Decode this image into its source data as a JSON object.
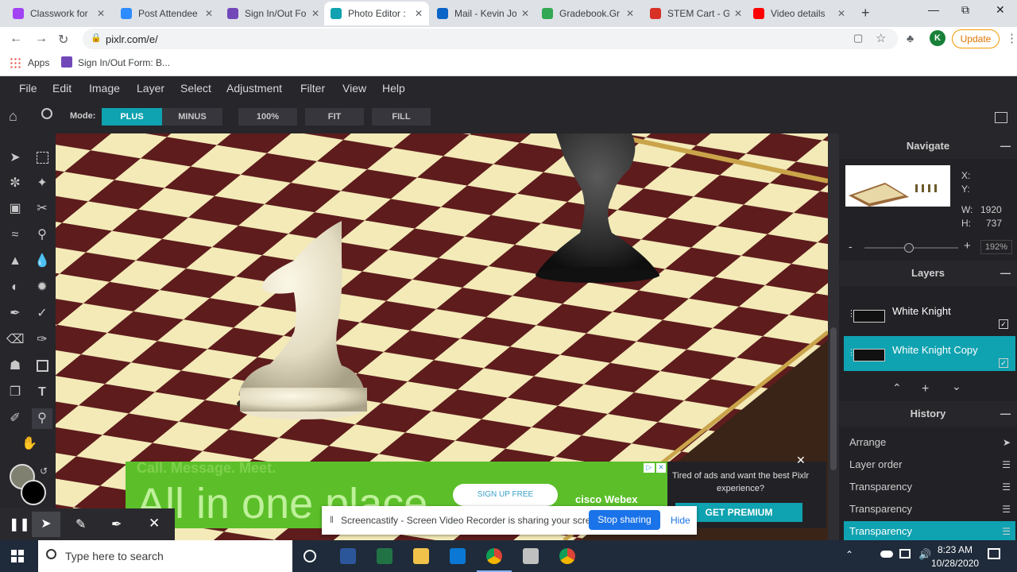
{
  "browser": {
    "tabs": [
      {
        "title": "Classwork for",
        "color": "#a142f4"
      },
      {
        "title": "Post Attendee",
        "color": "#2d8cff"
      },
      {
        "title": "Sign In/Out Fo",
        "color": "#7248b9"
      },
      {
        "title": "Photo Editor :",
        "color": "#0fa2b0"
      },
      {
        "title": "Mail - Kevin Jo",
        "color": "#0a64c8"
      },
      {
        "title": "Gradebook.Gr",
        "color": "#34a853"
      },
      {
        "title": "STEM Cart - G",
        "color": "#d93025"
      },
      {
        "title": "Video details",
        "color": "#ff0000"
      }
    ],
    "url": "pixlr.com/e/",
    "profile_initial": "K",
    "update_label": "Update",
    "bookmarks": [
      {
        "label": "Apps"
      },
      {
        "label": "Sign In/Out Form: B..."
      }
    ]
  },
  "menu": [
    "File",
    "Edit",
    "Image",
    "Layer",
    "Select",
    "Adjustment",
    "Filter",
    "View",
    "Help"
  ],
  "options": {
    "mode_label": "Mode:",
    "plus": "PLUS",
    "minus": "MINUS",
    "zoom100": "100%",
    "fit": "FIT",
    "fill": "FILL"
  },
  "navigate": {
    "title": "Navigate",
    "x_label": "X:",
    "y_label": "Y:",
    "w_label": "W:",
    "w_value": "1920",
    "h_label": "H:",
    "h_value": "737",
    "zoom": "192%",
    "minus": "-",
    "plus": "+"
  },
  "layers": {
    "title": "Layers",
    "items": [
      {
        "name": "White Knight",
        "selected": false
      },
      {
        "name": "White Knight Copy",
        "selected": true
      }
    ]
  },
  "history": {
    "title": "History",
    "items": [
      {
        "label": "Arrange",
        "selected": false
      },
      {
        "label": "Layer order",
        "selected": false
      },
      {
        "label": "Transparency",
        "selected": false
      },
      {
        "label": "Transparency",
        "selected": false
      },
      {
        "label": "Transparency",
        "selected": true
      }
    ]
  },
  "ad": {
    "headline": "All in one place",
    "faint": "Call. Message. Meet.",
    "signup": "SIGN UP FREE",
    "brand": "cisco Webex",
    "premium_text": "Tired of ads and want the best Pixlr experience?",
    "premium_button": "GET PREMIUM"
  },
  "screencastify": {
    "message": "Screencastify - Screen Video Recorder is sharing your screen.",
    "stop": "Stop sharing",
    "hide": "Hide"
  },
  "taskbar": {
    "search_placeholder": "Type here to search",
    "time": "8:23 AM",
    "date": "10/28/2020"
  }
}
